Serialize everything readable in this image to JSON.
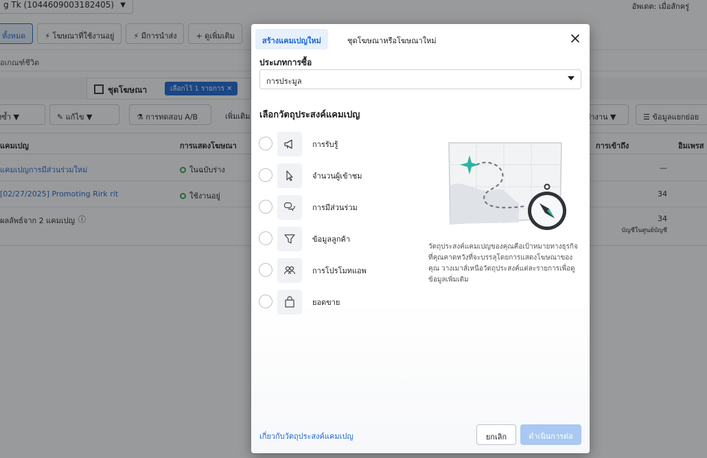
{
  "background": {
    "account_select": "g Tk (1044609003182405)",
    "updated_label": "อัพเดต: เมื่อสักครู่",
    "filters": [
      {
        "label": "ทั้งหมด",
        "icon": "none",
        "active": true
      },
      {
        "label": "โฆษณาที่ใช้งานอยู่",
        "icon": "bolt-icon",
        "active": false
      },
      {
        "label": "มีการนำส่ง",
        "icon": "bolt-icon",
        "active": false
      },
      {
        "label": "ดูเพิ่มเติม",
        "icon": "plus-icon",
        "active": false
      }
    ],
    "breadcrumb": "อเกณฑ์ชีวิต",
    "adset_tab": "ชุดโฆษณา",
    "selected_pill": "เลือกไว้ 1 รายการ",
    "toolbar": {
      "duplicate": "งซ้ำ",
      "edit": "แก้ไข",
      "ab_test": "การทดสอบ A/B",
      "more": "เพิ่มเติม",
      "work": "ทำงาน",
      "breakdown": "ข้อมูลแยกย่อย"
    },
    "table": {
      "columns": [
        "แคมเปญ",
        "การแสดงโฆษณา",
        "การเข้าถึง",
        "อิมเพรส"
      ],
      "rows": [
        {
          "name": "แคมเปญการมีส่วนร่วมใหม่",
          "status": "ในฉบับร่าง",
          "reach": "—"
        },
        {
          "name": "[02/27/2025] Promoting Rirk rit",
          "status": "ใช้งานอยู่",
          "reach": "34"
        }
      ],
      "summary_label": "ผลลัพธ์จาก 2 แคมเปญ",
      "summary_reach": "34",
      "summary_note": "บัญชีในศูนย์บัญชี"
    }
  },
  "modal": {
    "tabs": [
      {
        "label": "สร้างแคมเปญใหม่",
        "active": true
      },
      {
        "label": "ชุดโฆษณาหรือโฆษณาใหม่",
        "active": false
      }
    ],
    "buy_type_label": "ประเภทการซื้อ",
    "buy_type_value": "การประมูล",
    "objective_title": "เลือกวัตถุประสงค์แคมเปญ",
    "objectives": [
      {
        "label": "การรับรู้",
        "icon": "megaphone-icon"
      },
      {
        "label": "จำนวนผู้เข้าชม",
        "icon": "cursor-icon"
      },
      {
        "label": "การมีส่วนร่วม",
        "icon": "chat-bubbles-icon"
      },
      {
        "label": "ข้อมูลลูกค้า",
        "icon": "funnel-icon"
      },
      {
        "label": "การโปรโมทแอพ",
        "icon": "people-icon"
      },
      {
        "label": "ยอดขาย",
        "icon": "shopping-bag-icon"
      }
    ],
    "illustration": "map-compass-illustration",
    "description": "วัตถุประสงค์แคมเปญของคุณคือเป้าหมายทางธุรกิจที่คุณคาดหวังที่จะบรรลุโดยการแสดงโฆษณาของคุณ วางเมาส์เหนือวัตถุประสงค์แต่ละรายการเพื่อดูข้อมูลเพิ่มเติม",
    "learn_more": "เกี่ยวกับวัตถุประสงค์แคมเปญ",
    "cancel": "ยกเลิก",
    "continue": "ดำเนินการต่อ"
  },
  "colors": {
    "accent": "#1a66d6",
    "accent_light": "#e7f0fd",
    "continue_disabled": "#a9c8f2",
    "illustration_teal": "#2bb5a0"
  }
}
